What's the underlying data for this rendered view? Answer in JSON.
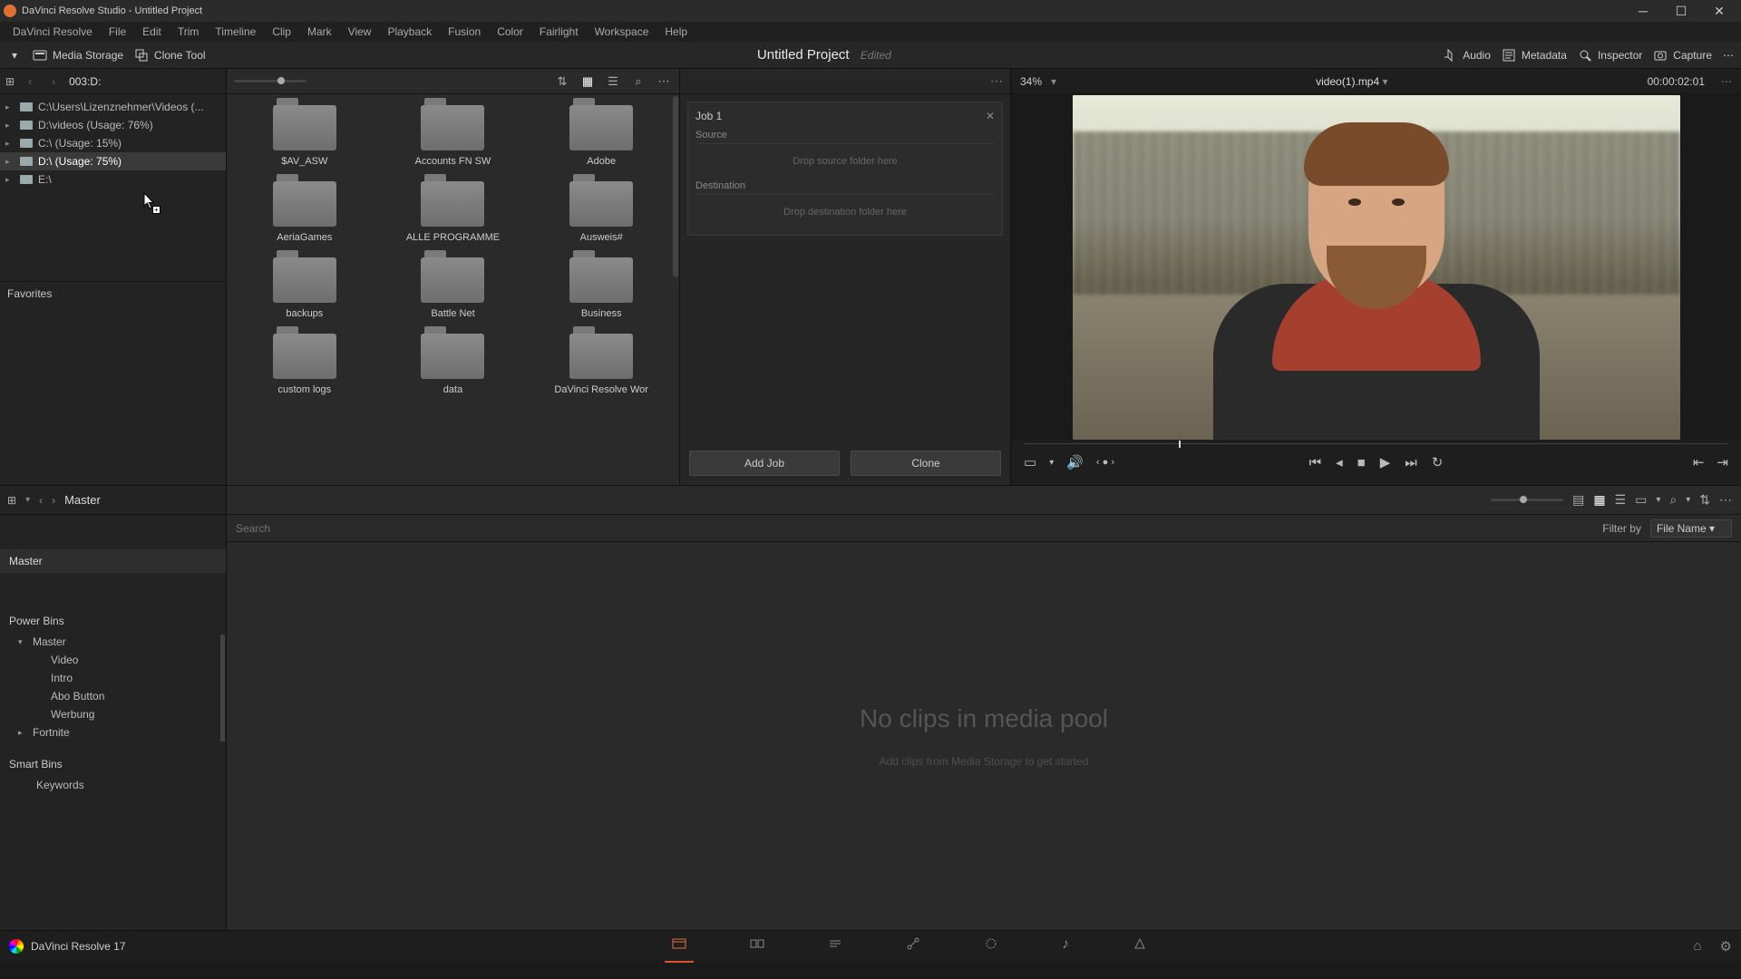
{
  "window": {
    "title": "DaVinci Resolve Studio - Untitled Project"
  },
  "menu": {
    "items": [
      "DaVinci Resolve",
      "File",
      "Edit",
      "Trim",
      "Timeline",
      "Clip",
      "Mark",
      "View",
      "Playback",
      "Fusion",
      "Color",
      "Fairlight",
      "Workspace",
      "Help"
    ]
  },
  "toolbar": {
    "media_storage": "Media Storage",
    "clone_tool": "Clone Tool",
    "project_title": "Untitled Project",
    "edited": "Edited",
    "audio": "Audio",
    "metadata": "Metadata",
    "inspector": "Inspector",
    "capture": "Capture"
  },
  "storage": {
    "path_label": "003:D:",
    "tree": [
      {
        "label": "C:\\Users\\Lizenznehmer\\Videos (...",
        "selected": false
      },
      {
        "label": "D:\\videos (Usage: 76%)",
        "selected": false
      },
      {
        "label": "C:\\ (Usage: 15%)",
        "selected": false
      },
      {
        "label": "D:\\ (Usage: 75%)",
        "selected": true
      },
      {
        "label": "E:\\",
        "selected": false
      }
    ],
    "favorites_label": "Favorites"
  },
  "folders": [
    {
      "name": "$AV_ASW"
    },
    {
      "name": "Accounts FN SW"
    },
    {
      "name": "Adobe"
    },
    {
      "name": "AeriaGames"
    },
    {
      "name": "ALLE PROGRAMME"
    },
    {
      "name": "Ausweis#"
    },
    {
      "name": "backups"
    },
    {
      "name": "Battle Net"
    },
    {
      "name": "Business"
    },
    {
      "name": "custom logs"
    },
    {
      "name": "data"
    },
    {
      "name": "DaVinci Resolve Wor"
    }
  ],
  "clone": {
    "job_title": "Job 1",
    "source_label": "Source",
    "source_hint": "Drop source folder here",
    "dest_label": "Destination",
    "dest_hint": "Drop destination folder here",
    "add_job": "Add Job",
    "clone_btn": "Clone"
  },
  "viewer": {
    "zoom": "34%",
    "clip": "video(1).mp4",
    "timecode": "00:00:02:01"
  },
  "bins": {
    "crumb": "Master",
    "master": "Master",
    "powerbins_label": "Power Bins",
    "powerbins": [
      {
        "label": "Master",
        "level": 1,
        "exp": "▾"
      },
      {
        "label": "Video",
        "level": 2,
        "exp": ""
      },
      {
        "label": "Intro",
        "level": 2,
        "exp": ""
      },
      {
        "label": "Abo Button",
        "level": 2,
        "exp": ""
      },
      {
        "label": "Werbung",
        "level": 2,
        "exp": ""
      },
      {
        "label": "Fortnite",
        "level": 1,
        "exp": "▸"
      }
    ],
    "smartbins_label": "Smart Bins",
    "smartbins": [
      {
        "label": "Keywords"
      }
    ]
  },
  "mediapool": {
    "search_placeholder": "Search",
    "filter_label": "Filter by",
    "filter_value": "File Name",
    "empty_title": "No clips in media pool",
    "empty_sub": "Add clips from Media Storage to get started"
  },
  "footer": {
    "app": "DaVinci Resolve 17"
  }
}
